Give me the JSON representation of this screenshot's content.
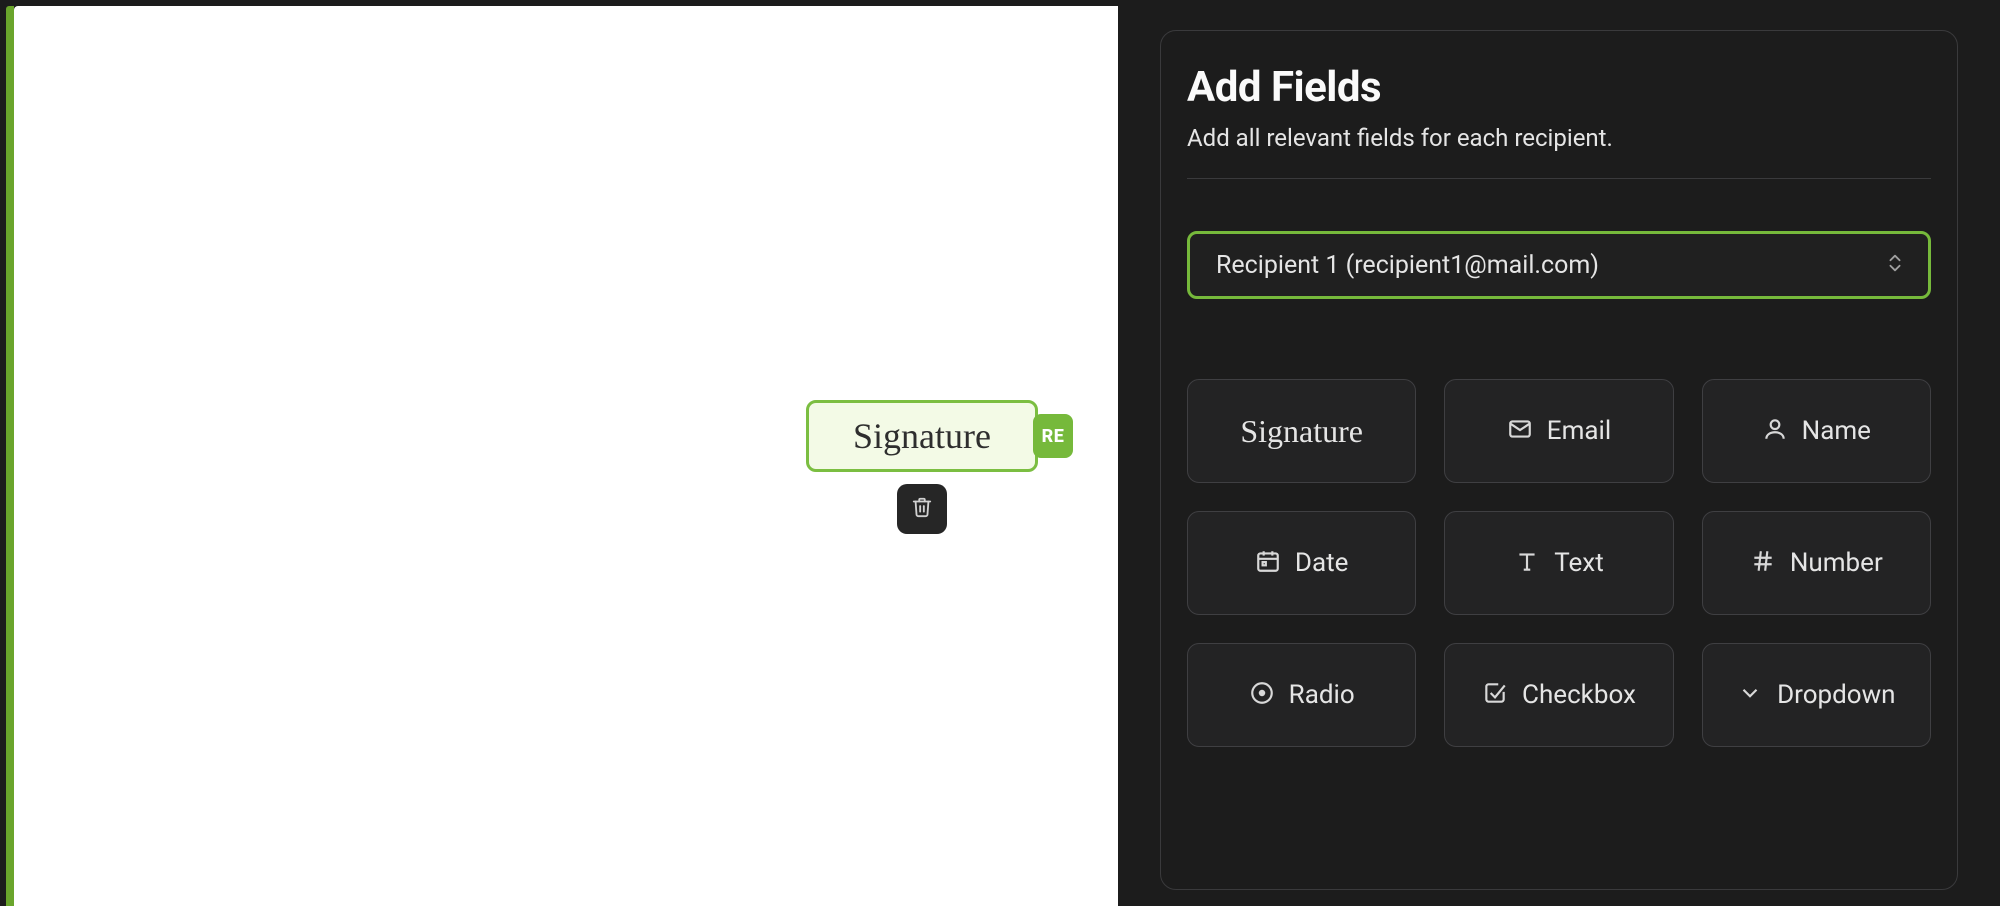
{
  "canvas": {
    "placed_field": {
      "label": "Signature",
      "recipient_badge": "RE"
    }
  },
  "sidebar": {
    "title": "Add Fields",
    "subtitle": "Add all relevant fields for each recipient.",
    "recipient_selected": "Recipient 1 (recipient1@mail.com)",
    "fields": {
      "signature": "Signature",
      "email": "Email",
      "name": "Name",
      "date": "Date",
      "text": "Text",
      "number": "Number",
      "radio": "Radio",
      "checkbox": "Checkbox",
      "dropdown": "Dropdown"
    }
  }
}
